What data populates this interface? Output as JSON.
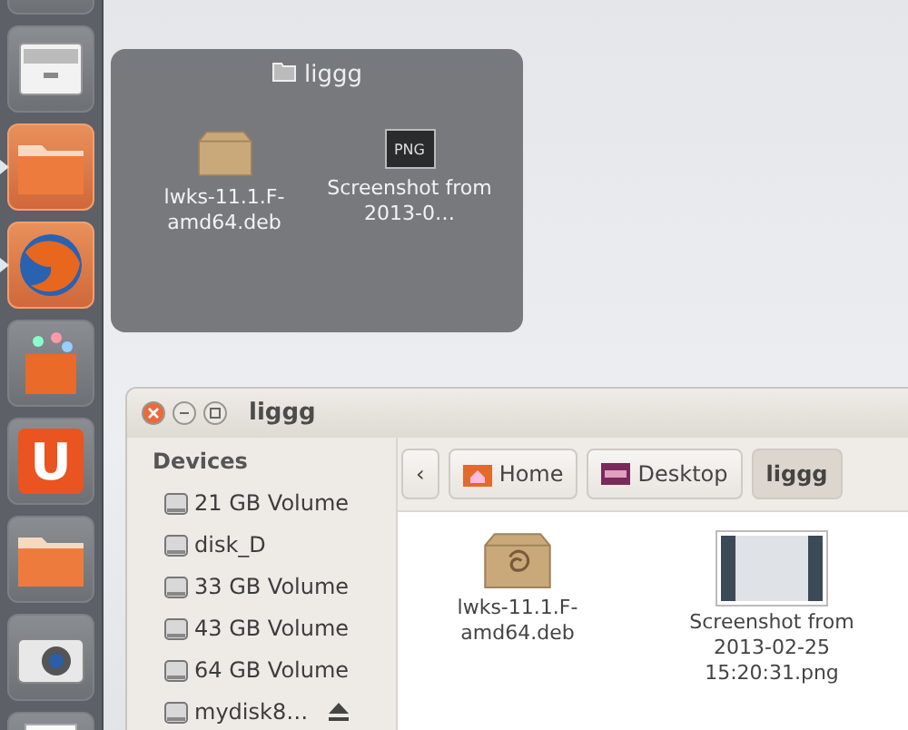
{
  "launcher": [
    {
      "kind": "app-partial",
      "running": false
    },
    {
      "kind": "drawer",
      "running": false
    },
    {
      "kind": "folder",
      "running": true
    },
    {
      "kind": "browser",
      "running": true
    },
    {
      "kind": "store",
      "running": false
    },
    {
      "kind": "letter",
      "label": "U",
      "running": false
    },
    {
      "kind": "folder",
      "running": false
    },
    {
      "kind": "camera",
      "running": false
    },
    {
      "kind": "document",
      "running": false
    }
  ],
  "preview": {
    "title": "liggg",
    "items": [
      {
        "kind": "package",
        "name": "lwks-11.1.F-amd64.deb"
      },
      {
        "kind": "image",
        "badge": "PNG",
        "name": "Screenshot from 2013-0…"
      }
    ]
  },
  "window": {
    "title": "liggg",
    "sidebar": {
      "heading": "Devices",
      "items": [
        {
          "name": "21 GB Volume",
          "eject": false
        },
        {
          "name": "disk_D",
          "eject": false
        },
        {
          "name": "33 GB Volume",
          "eject": false
        },
        {
          "name": "43 GB Volume",
          "eject": false
        },
        {
          "name": "64 GB Volume",
          "eject": false
        },
        {
          "name": "mydisk8…",
          "eject": true
        }
      ]
    },
    "path": {
      "back": "‹",
      "crumbs": [
        {
          "kind": "home",
          "label": "Home",
          "selected": false
        },
        {
          "kind": "desktop",
          "label": "Desktop",
          "selected": false
        },
        {
          "kind": "plain",
          "label": "liggg",
          "selected": true
        }
      ]
    },
    "files": [
      {
        "kind": "package",
        "name": "lwks-11.1.F-amd64.deb"
      },
      {
        "kind": "image",
        "name": "Screenshot from 2013-02-25 15:20:31.png"
      }
    ]
  }
}
